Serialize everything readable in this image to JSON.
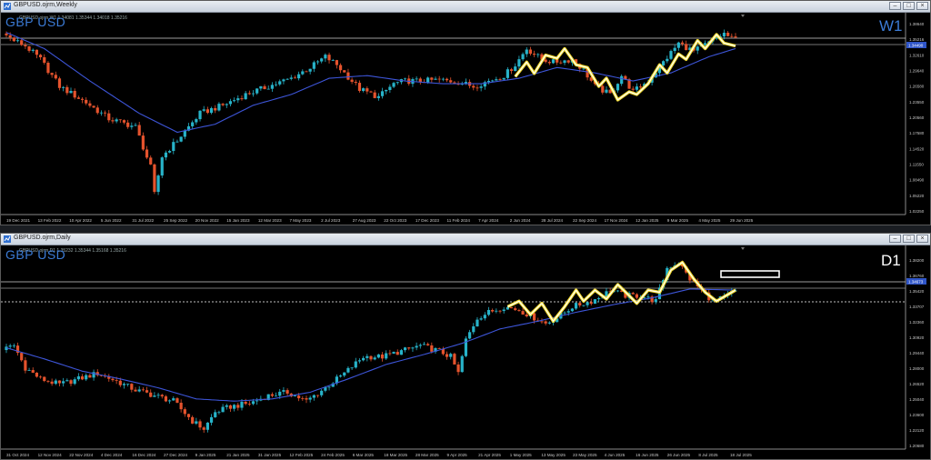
{
  "windows": [
    {
      "id": "weekly",
      "title": "GBPUSD.ojrm,Weekly",
      "ohlc_info": "GBPUSD.ojrm,W1  1.34081 1.35344 1.34018 1.35216",
      "symbol_label": "GBP USD",
      "timeframe_label": "W1",
      "timeframe_color": "#3b7bd6",
      "price_labels": [
        "1.38640",
        "1.35216",
        "1.32610",
        "1.29640",
        "1.26580",
        "1.23550",
        "1.20560",
        "1.17580",
        "1.14520",
        "1.11550",
        "1.08490",
        "1.05220",
        "1.02250"
      ],
      "current_price": "1.34490",
      "date_labels": [
        "19 Dec 2021",
        "13 Feb 2022",
        "10 Apr 2022",
        "5 Jun 2022",
        "31 Jul 2022",
        "25 Sep 2022",
        "20 Nov 2022",
        "15 Jan 2023",
        "12 Mar 2023",
        "7 May 2023",
        "2 Jul 2023",
        "27 Aug 2023",
        "22 Oct 2023",
        "17 Dec 2023",
        "11 Feb 2024",
        "7 Apr 2024",
        "2 Jun 2024",
        "28 Jul 2024",
        "22 Sep 2024",
        "17 Nov 2024",
        "12 Jan 2025",
        "9 Mar 2025",
        "4 May 2025",
        "29 Jun 2025"
      ]
    },
    {
      "id": "daily",
      "title": "GBPUSD.ojrm,Daily",
      "ohlc_info": "GBPUSD.ojrm,D1  1.35232 1.35344 1.35168 1.35216",
      "symbol_label": "GBP USD",
      "timeframe_label": "D1",
      "timeframe_color": "#ffffff",
      "price_labels": [
        "1.38200",
        "1.36760",
        "1.35420",
        "1.33707",
        "1.32360",
        "1.30920",
        "1.29440",
        "1.28000",
        "1.26520",
        "1.25040",
        "1.23600",
        "1.22120",
        "1.20680"
      ],
      "current_price": "1.34673",
      "date_labels": [
        "31 Oct 2024",
        "12 Nov 2024",
        "22 Nov 2024",
        "4 Dec 2024",
        "16 Dec 2024",
        "27 Dec 2024",
        "9 Jan 2025",
        "21 Jan 2025",
        "31 Jan 2025",
        "12 Feb 2025",
        "24 Feb 2025",
        "6 Mar 2025",
        "18 Mar 2025",
        "28 Mar 2025",
        "9 Apr 2025",
        "21 Apr 2025",
        "1 May 2025",
        "13 May 2025",
        "23 May 2025",
        "4 Jun 2025",
        "16 Jun 2025",
        "26 Jun 2025",
        "8 Jul 2025",
        "18 Jul 2025"
      ]
    }
  ],
  "colors": {
    "bull": "#27b3c9",
    "bear": "#e5532d",
    "ma": "#3d55d8",
    "zigzag_outer": "#f4dd31",
    "zigzag_inner": "#ffffff",
    "background": "#000000"
  },
  "chart_data": [
    {
      "type": "candlestick",
      "title": "GBPUSD.ojrm,Weekly",
      "timeframe": "W1",
      "x_range": [
        "19 Dec 2021",
        "29 Jun 2025"
      ],
      "ylim": [
        1.0225,
        1.3864
      ],
      "anchors": [
        [
          0,
          1.358
        ],
        [
          3,
          1.345
        ],
        [
          6,
          1.335
        ],
        [
          10,
          1.31
        ],
        [
          15,
          1.26
        ],
        [
          22,
          1.23
        ],
        [
          28,
          1.2
        ],
        [
          35,
          1.185
        ],
        [
          39,
          1.11
        ],
        [
          40,
          1.06
        ],
        [
          42,
          1.13
        ],
        [
          46,
          1.16
        ],
        [
          52,
          1.21
        ],
        [
          58,
          1.225
        ],
        [
          64,
          1.245
        ],
        [
          70,
          1.26
        ],
        [
          76,
          1.275
        ],
        [
          81,
          1.295
        ],
        [
          85,
          1.315
        ],
        [
          88,
          1.3
        ],
        [
          94,
          1.255
        ],
        [
          99,
          1.24
        ],
        [
          103,
          1.265
        ],
        [
          106,
          1.27
        ],
        [
          110,
          1.27
        ],
        [
          115,
          1.272
        ],
        [
          120,
          1.268
        ],
        [
          124,
          1.26
        ],
        [
          128,
          1.27
        ],
        [
          132,
          1.28
        ],
        [
          135,
          1.3
        ],
        [
          138,
          1.33
        ],
        [
          142,
          1.31
        ],
        [
          145,
          1.305
        ],
        [
          150,
          1.31
        ],
        [
          153,
          1.29
        ],
        [
          156,
          1.26
        ],
        [
          160,
          1.245
        ],
        [
          163,
          1.28
        ],
        [
          166,
          1.25
        ],
        [
          170,
          1.27
        ],
        [
          174,
          1.305
        ],
        [
          178,
          1.34
        ],
        [
          182,
          1.325
        ],
        [
          187,
          1.345
        ],
        [
          190,
          1.358
        ],
        [
          192,
          1.348
        ]
      ],
      "ma_anchors": [
        [
          0,
          1.36
        ],
        [
          10,
          1.33
        ],
        [
          22,
          1.27
        ],
        [
          35,
          1.21
        ],
        [
          45,
          1.175
        ],
        [
          55,
          1.19
        ],
        [
          65,
          1.225
        ],
        [
          75,
          1.245
        ],
        [
          85,
          1.275
        ],
        [
          95,
          1.28
        ],
        [
          105,
          1.27
        ],
        [
          115,
          1.265
        ],
        [
          125,
          1.265
        ],
        [
          135,
          1.275
        ],
        [
          145,
          1.295
        ],
        [
          155,
          1.285
        ],
        [
          165,
          1.27
        ],
        [
          175,
          1.285
        ],
        [
          185,
          1.315
        ],
        [
          192,
          1.33
        ]
      ],
      "zigzag": [
        [
          134,
          1.278
        ],
        [
          137,
          1.305
        ],
        [
          139,
          1.284
        ],
        [
          142,
          1.318
        ],
        [
          145,
          1.312
        ],
        [
          147,
          1.33
        ],
        [
          150,
          1.3
        ],
        [
          153,
          1.295
        ],
        [
          156,
          1.26
        ],
        [
          158,
          1.275
        ],
        [
          161,
          1.235
        ],
        [
          164,
          1.25
        ],
        [
          166,
          1.245
        ],
        [
          169,
          1.265
        ],
        [
          172,
          1.3
        ],
        [
          174,
          1.285
        ],
        [
          177,
          1.32
        ],
        [
          179,
          1.31
        ],
        [
          182,
          1.345
        ],
        [
          184,
          1.33
        ],
        [
          187,
          1.356
        ],
        [
          189,
          1.34
        ],
        [
          192,
          1.335
        ]
      ],
      "candles": 193
    },
    {
      "type": "candlestick",
      "title": "GBPUSD.ojrm,Daily",
      "timeframe": "D1",
      "x_range": [
        "31 Oct 2024",
        "18 Jul 2025"
      ],
      "ylim": [
        1.2068,
        1.382
      ],
      "anchors": [
        [
          0,
          1.296
        ],
        [
          3,
          1.3
        ],
        [
          6,
          1.28
        ],
        [
          10,
          1.27
        ],
        [
          15,
          1.265
        ],
        [
          20,
          1.27
        ],
        [
          25,
          1.275
        ],
        [
          30,
          1.268
        ],
        [
          35,
          1.26
        ],
        [
          40,
          1.255
        ],
        [
          45,
          1.25
        ],
        [
          50,
          1.232
        ],
        [
          53,
          1.225
        ],
        [
          56,
          1.24
        ],
        [
          60,
          1.245
        ],
        [
          65,
          1.248
        ],
        [
          70,
          1.255
        ],
        [
          75,
          1.258
        ],
        [
          80,
          1.25
        ],
        [
          85,
          1.262
        ],
        [
          90,
          1.275
        ],
        [
          95,
          1.29
        ],
        [
          100,
          1.29
        ],
        [
          105,
          1.295
        ],
        [
          110,
          1.3
        ],
        [
          115,
          1.295
        ],
        [
          118,
          1.29
        ],
        [
          120,
          1.275
        ],
        [
          122,
          1.305
        ],
        [
          125,
          1.325
        ],
        [
          128,
          1.33
        ],
        [
          132,
          1.335
        ],
        [
          136,
          1.332
        ],
        [
          140,
          1.325
        ],
        [
          143,
          1.32
        ],
        [
          146,
          1.325
        ],
        [
          150,
          1.335
        ],
        [
          155,
          1.34
        ],
        [
          158,
          1.345
        ],
        [
          160,
          1.35
        ],
        [
          164,
          1.345
        ],
        [
          168,
          1.345
        ],
        [
          172,
          1.34
        ],
        [
          175,
          1.37
        ],
        [
          178,
          1.375
        ],
        [
          181,
          1.36
        ],
        [
          184,
          1.35
        ],
        [
          187,
          1.34
        ],
        [
          190,
          1.343
        ],
        [
          192,
          1.348
        ]
      ],
      "ma_anchors": [
        [
          0,
          1.298
        ],
        [
          10,
          1.288
        ],
        [
          20,
          1.277
        ],
        [
          30,
          1.27
        ],
        [
          40,
          1.262
        ],
        [
          50,
          1.252
        ],
        [
          60,
          1.25
        ],
        [
          70,
          1.252
        ],
        [
          80,
          1.258
        ],
        [
          90,
          1.27
        ],
        [
          100,
          1.283
        ],
        [
          110,
          1.292
        ],
        [
          120,
          1.302
        ],
        [
          130,
          1.315
        ],
        [
          140,
          1.322
        ],
        [
          150,
          1.33
        ],
        [
          160,
          1.337
        ],
        [
          170,
          1.343
        ],
        [
          180,
          1.351
        ],
        [
          192,
          1.35
        ]
      ],
      "zigzag": [
        [
          132,
          1.335
        ],
        [
          135,
          1.34
        ],
        [
          138,
          1.328
        ],
        [
          141,
          1.338
        ],
        [
          144,
          1.322
        ],
        [
          147,
          1.335
        ],
        [
          150,
          1.35
        ],
        [
          152,
          1.34
        ],
        [
          155,
          1.35
        ],
        [
          158,
          1.342
        ],
        [
          161,
          1.355
        ],
        [
          164,
          1.345
        ],
        [
          166,
          1.338
        ],
        [
          169,
          1.35
        ],
        [
          172,
          1.348
        ],
        [
          175,
          1.368
        ],
        [
          178,
          1.375
        ],
        [
          181,
          1.36
        ],
        [
          184,
          1.348
        ],
        [
          187,
          1.34
        ],
        [
          190,
          1.346
        ],
        [
          192,
          1.35
        ]
      ],
      "candles": 193
    }
  ]
}
